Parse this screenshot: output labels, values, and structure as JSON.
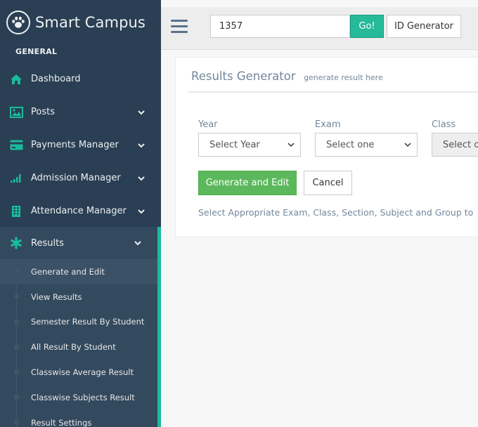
{
  "brand": {
    "title": "Smart Campus",
    "logo_icon": "paw-icon"
  },
  "sidebar": {
    "section_title": "GENERAL",
    "items": [
      {
        "label": "Dashboard",
        "icon": "home-icon"
      },
      {
        "label": "Posts",
        "icon": "image-icon"
      },
      {
        "label": "Payments Manager",
        "icon": "credit-card-icon"
      },
      {
        "label": "Admission Manager",
        "icon": "signal-bars-icon"
      },
      {
        "label": "Attendance Manager",
        "icon": "building-icon"
      },
      {
        "label": "Results",
        "icon": "asterisk-icon"
      }
    ],
    "results_sub": [
      "Generate and Edit",
      "View Results",
      "Semester Result By Student",
      "All Result By Student",
      "Classwise Average Result",
      "Classwise Subjects Result",
      "Result Settings"
    ]
  },
  "topbar": {
    "search_value": "1357",
    "go_label": "Go!",
    "id_generator_label": "ID Generator"
  },
  "panel": {
    "title": "Results Generator",
    "subtitle": "generate result here",
    "fields": [
      {
        "label": "Year",
        "value": "Select Year"
      },
      {
        "label": "Exam",
        "value": "Select one"
      },
      {
        "label": "Class",
        "value": "Select o"
      }
    ],
    "generate_label": "Generate and Edit",
    "cancel_label": "Cancel",
    "help_text": "Select Appropriate Exam, Class, Section, Subject and Group to"
  },
  "colors": {
    "sidebar_bg": "#2a3f54",
    "accent": "#1abb9c",
    "go_green": "#26b99a",
    "generate_green": "#5cb85c",
    "icon_green": "#1abb9c"
  }
}
